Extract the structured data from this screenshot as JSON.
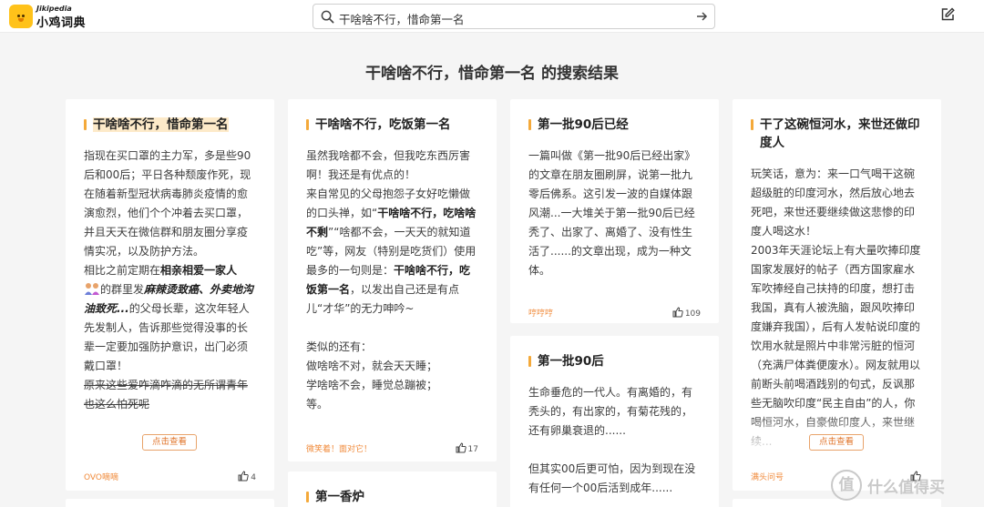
{
  "app": {
    "logo_en": "Jikipedia",
    "logo_cn": "小鸡词典"
  },
  "search": {
    "query": "干啥啥不行，惜命第一名"
  },
  "page_title": "干啥啥不行，惜命第一名 的搜索结果",
  "cards": {
    "c1": {
      "title": "干啥啥不行，惜命第一名",
      "p1": "指现在买口罩的主力军，多是些90后和00后；平日各种颓废作死，现在随着新型冠状病毒肺炎疫情的愈演愈烈，他们个个冲着去买口罩，并且天天在微信群和朋友圈分享疫情实况，以及防护方法。",
      "p2a": "相比之前定期在",
      "p2b": "相亲相爱一家人",
      "p2c": "的群里发",
      "p2d": "麻辣烫致癌、外卖地沟油致死...",
      "p2e": "的父母长辈，这次年轻人先发制人，告诉那些觉得没事的长辈一定要加强防护意识，出门必须戴口罩！",
      "p3": "原来这些爱咋滴咋滴的无所谓青年也这么怕死呢",
      "more": "点击查看",
      "author": "OVO嘀嘀",
      "likes": "4"
    },
    "c2": {
      "title": "干啥啥不行，吃饭第一名",
      "p1": "虽然我啥都不会，但我吃东西厉害啊！我还是有优点的！",
      "p2a": "来自常见的父母抱怨子女好吃懒做的口头禅，如“",
      "p2b": "干啥啥不行，吃啥啥不剩",
      "p2c": "”“啥都不会，一天天的就知道吃”等，网友（特别是吃货们）使用最多的一句则是：",
      "p2d": "干啥啥不行，吃饭第一名",
      "p2e": "，以发出自己还是有点儿“才华”的无力呻吟~",
      "p3": "类似的还有：",
      "p4": "做啥啥不对，就会天天睡；",
      "p5": "学啥啥不会，睡觉总蹦被；",
      "p6": "等。",
      "author": "微笑着！面对它！",
      "likes": "17"
    },
    "c3": {
      "title": "第一批90后已经",
      "p1": "一篇叫做《第一批90后已经出家》的文章在朋友圈刷屏，说第一批九零后佛系。这引发一波的自媒体跟风潮...一大堆关于第一批90后已经秃了、出家了、离婚了、没有性生活了......的文章出现，成为一种文体。",
      "author": "哼哼哼",
      "likes": "109"
    },
    "c4": {
      "title": "第一批90后",
      "p1": "生命垂危的一代人。有离婚的，有秃头的，有出家的，有菊花残的，还有卵巢衰退的......",
      "p2": "但其实00后更可怕，因为到现在没有任何一个00后活到成年......"
    },
    "c5": {
      "title": "干了这碗恒河水，来世还做印度人",
      "p1": "玩笑话，意为：来一口气喝干这碗超级脏的印度河水，然后放心地去死吧，来世还要继续做这悲惨的印度人喝这水！",
      "p2": "2003年天涯论坛上有大量吹捧印度国家发展好的帖子（西方国家雇水军吹捧经自己扶持的印度，想打击我国，真有人被洗脑，跟风吹捧印度嫌弃我国），后有人发帖说印度的饮用水就是照片中非常污脏的恒河（充满尸体粪便废水）。网友就用以前断头前喝酒践别的句式，反讽那些无脑吹印度“民主自由”的人，你喝恒河水，自豪做印度人，来世继续...",
      "more": "点击查看",
      "author": "满头问号",
      "likes": ""
    },
    "c6": {
      "title": "第一香炉"
    }
  },
  "watermark": {
    "glyph": "值",
    "text": "什么值得买"
  },
  "colors": {
    "accent": "#f4a93a",
    "author": "#f08a3a",
    "highlight": "#fdeac9"
  }
}
